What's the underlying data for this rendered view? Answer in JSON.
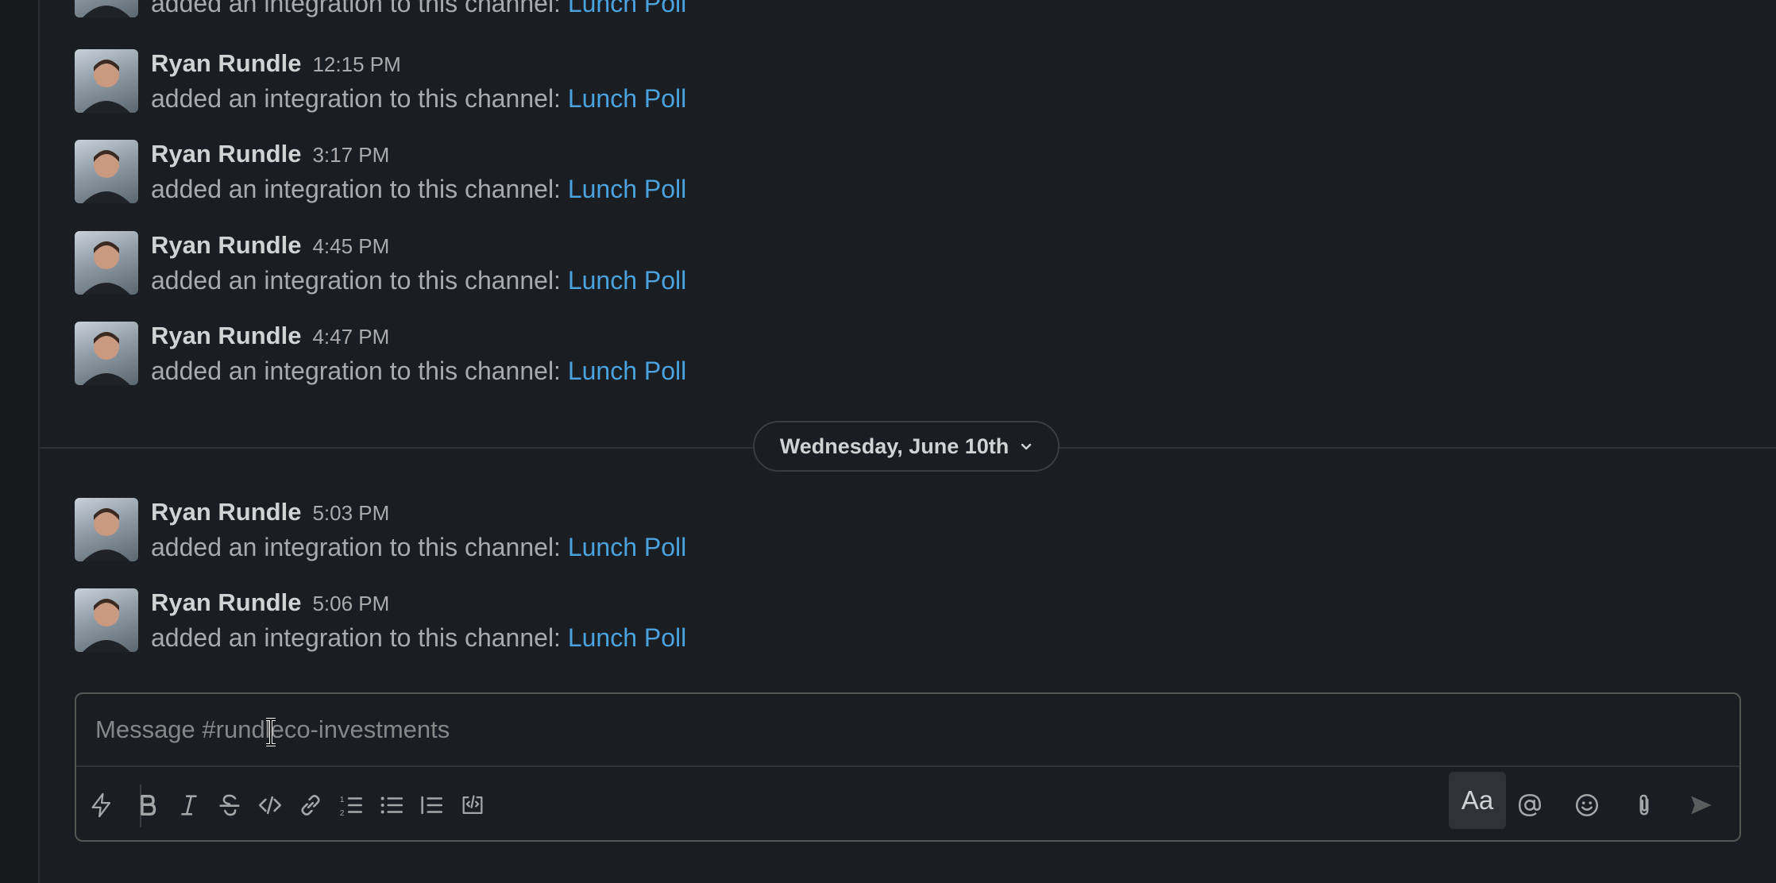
{
  "channel": {
    "placeholder": "Message #rundleco-investments"
  },
  "messages_before": [
    {
      "author": "",
      "time": "",
      "text": "added an integration to this channel:",
      "link": "Lunch Poll"
    },
    {
      "author": "Ryan Rundle",
      "time": "12:15 PM",
      "text": "added an integration to this channel:",
      "link": "Lunch Poll"
    },
    {
      "author": "Ryan Rundle",
      "time": "3:17 PM",
      "text": "added an integration to this channel:",
      "link": "Lunch Poll"
    },
    {
      "author": "Ryan Rundle",
      "time": "4:45 PM",
      "text": "added an integration to this channel:",
      "link": "Lunch Poll"
    },
    {
      "author": "Ryan Rundle",
      "time": "4:47 PM",
      "text": "added an integration to this channel:",
      "link": "Lunch Poll"
    }
  ],
  "date_divider": {
    "label": "Wednesday, June 10th"
  },
  "messages_after": [
    {
      "author": "Ryan Rundle",
      "time": "5:03 PM",
      "text": "added an integration to this channel:",
      "link": "Lunch Poll"
    },
    {
      "author": "Ryan Rundle",
      "time": "5:06 PM",
      "text": "added an integration to this channel:",
      "link": "Lunch Poll"
    }
  ],
  "toolbar": {
    "format_label": "Aa"
  },
  "colors": {
    "background": "#1a1d21",
    "link": "#4aa3df",
    "border": "#565856"
  },
  "icons": [
    "shortcuts-icon",
    "bold-icon",
    "italic-icon",
    "strikethrough-icon",
    "code-icon",
    "link-icon",
    "ordered-list-icon",
    "bulleted-list-icon",
    "blockquote-icon",
    "code-block-icon",
    "mention-icon",
    "emoji-icon",
    "attach-icon",
    "send-icon"
  ]
}
